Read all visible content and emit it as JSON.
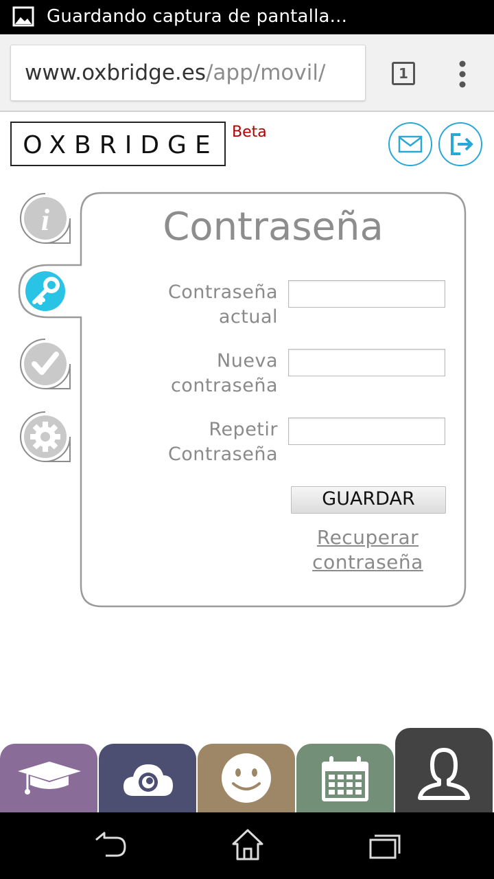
{
  "status_bar": {
    "text": "Guardando captura de pantalla...",
    "icon": "image-icon"
  },
  "browser": {
    "url_domain": "www.oxbridge.es",
    "url_path": "/app/movil/",
    "tab_count": "1",
    "menu_icon": "more-vert-icon"
  },
  "header": {
    "logo": "OXBRIDGE",
    "beta": "Beta",
    "mail_icon": "mail-icon",
    "logout_icon": "logout-icon"
  },
  "side_menu": [
    {
      "name": "info",
      "icon": "info-icon",
      "active": false
    },
    {
      "name": "password",
      "icon": "key-icon",
      "active": true
    },
    {
      "name": "check",
      "icon": "check-icon",
      "active": false
    },
    {
      "name": "settings",
      "icon": "gear-icon",
      "active": false
    }
  ],
  "form": {
    "title": "Contraseña",
    "current_label_1": "Contraseña",
    "current_label_2": "actual",
    "current_value": "",
    "new_label_1": "Nueva",
    "new_label_2": "contraseña",
    "new_value": "",
    "repeat_label_1": "Repetir",
    "repeat_label_2": "Contraseña",
    "repeat_value": "",
    "save_label": "GUARDAR",
    "recover_1": "Recuperar",
    "recover_2": "contraseña"
  },
  "bottom_tabs": [
    {
      "name": "courses",
      "icon": "graduation-cap-icon",
      "color": "#8a6c99"
    },
    {
      "name": "cloud",
      "icon": "cloud-icon",
      "color": "#4d4f72"
    },
    {
      "name": "smile",
      "icon": "smiley-icon",
      "color": "#9e8767"
    },
    {
      "name": "calendar",
      "icon": "calendar-icon",
      "color": "#748f77"
    },
    {
      "name": "profile",
      "icon": "user-icon",
      "color": "#434343",
      "active": true
    }
  ],
  "colors": {
    "accent": "#29a7d7",
    "active_side": "#29c3e6",
    "side_grey": "#c9c9c9",
    "beta": "#b10000"
  }
}
